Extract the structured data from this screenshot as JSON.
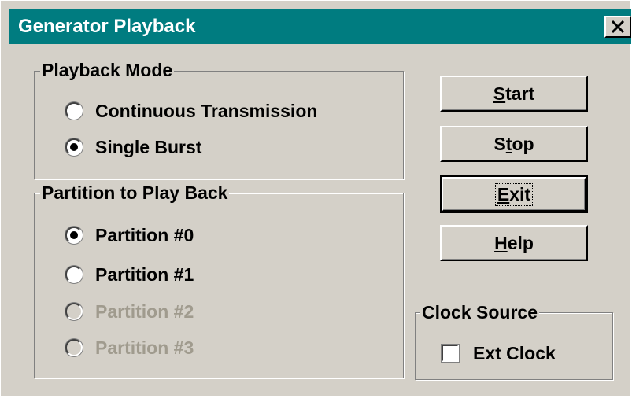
{
  "window": {
    "title": "Generator Playback"
  },
  "playback_mode": {
    "label": "Playback Mode",
    "options": [
      {
        "label": "Continuous Transmission",
        "selected": false,
        "enabled": true
      },
      {
        "label": "Single Burst",
        "selected": true,
        "enabled": true
      }
    ]
  },
  "partition": {
    "label": "Partition to Play Back",
    "options": [
      {
        "label": "Partition #0",
        "selected": true,
        "enabled": true
      },
      {
        "label": "Partition #1",
        "selected": false,
        "enabled": true
      },
      {
        "label": "Partition #2",
        "selected": false,
        "enabled": false
      },
      {
        "label": "Partition #3",
        "selected": false,
        "enabled": false
      }
    ]
  },
  "buttons": {
    "start": {
      "pre": "",
      "mnemonic": "S",
      "post": "tart"
    },
    "stop": {
      "pre": "S",
      "mnemonic": "t",
      "post": "op"
    },
    "exit": {
      "pre": "",
      "mnemonic": "E",
      "post": "xit"
    },
    "help": {
      "pre": "",
      "mnemonic": "H",
      "post": "elp"
    }
  },
  "clock_source": {
    "label": "Clock Source",
    "ext_clock": {
      "label": "Ext Clock",
      "checked": false
    }
  },
  "colors": {
    "titlebar": "#007c80",
    "face": "#d4d0c8",
    "disabled_text": "#a09b8e"
  }
}
